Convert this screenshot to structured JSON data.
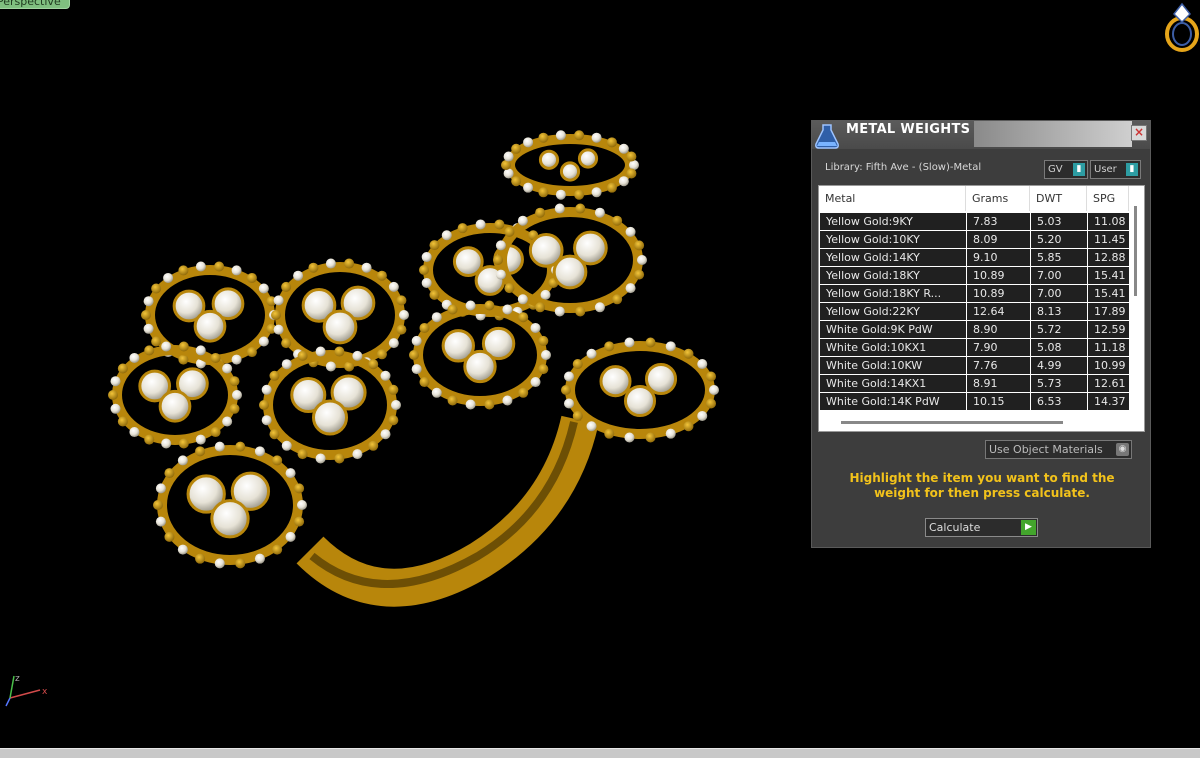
{
  "viewport": {
    "label": "Perspective"
  },
  "panel": {
    "title": "METAL WEIGHTS",
    "close": "×",
    "library": "Library: Fifth Ave - (Slow)-Metal",
    "combo_gv": "GV",
    "combo_user": "User",
    "columns": [
      "Metal",
      "Grams",
      "DWT",
      "SPG"
    ],
    "rows": [
      [
        "Yellow Gold:9KY",
        "7.83",
        "5.03",
        "11.08"
      ],
      [
        "Yellow Gold:10KY",
        "8.09",
        "5.20",
        "11.45"
      ],
      [
        "Yellow Gold:14KY",
        "9.10",
        "5.85",
        "12.88"
      ],
      [
        "Yellow Gold:18KY",
        "10.89",
        "7.00",
        "15.41"
      ],
      [
        "Yellow Gold:18KY R...",
        "10.89",
        "7.00",
        "15.41"
      ],
      [
        "Yellow Gold:22KY",
        "12.64",
        "8.13",
        "17.89"
      ],
      [
        "White Gold:9K PdW",
        "8.90",
        "5.72",
        "12.59"
      ],
      [
        "White Gold:10KX1",
        "7.90",
        "5.08",
        "11.18"
      ],
      [
        "White Gold:10KW",
        "7.76",
        "4.99",
        "10.99"
      ],
      [
        "White Gold:14KX1",
        "8.91",
        "5.73",
        "12.61"
      ],
      [
        "White Gold:14K PdW",
        "10.15",
        "6.53",
        "14.37"
      ]
    ],
    "use_object_materials": "Use Object Materials",
    "instructions": "Highlight the item you want to find the weight for then press calculate.",
    "calculate": "Calculate"
  },
  "colors": {
    "gold": "#c9960c",
    "instruction_text": "#f2c21b",
    "panel_bg": "#3d3d3d",
    "accent_green": "#43a52c",
    "accent_teal": "#2d9da3"
  },
  "icons": [
    "ring-logo-icon",
    "metal-weights-flask-icon",
    "close-icon",
    "dropdown-arrow-icon",
    "play-icon",
    "axis-gizmo-icon"
  ]
}
